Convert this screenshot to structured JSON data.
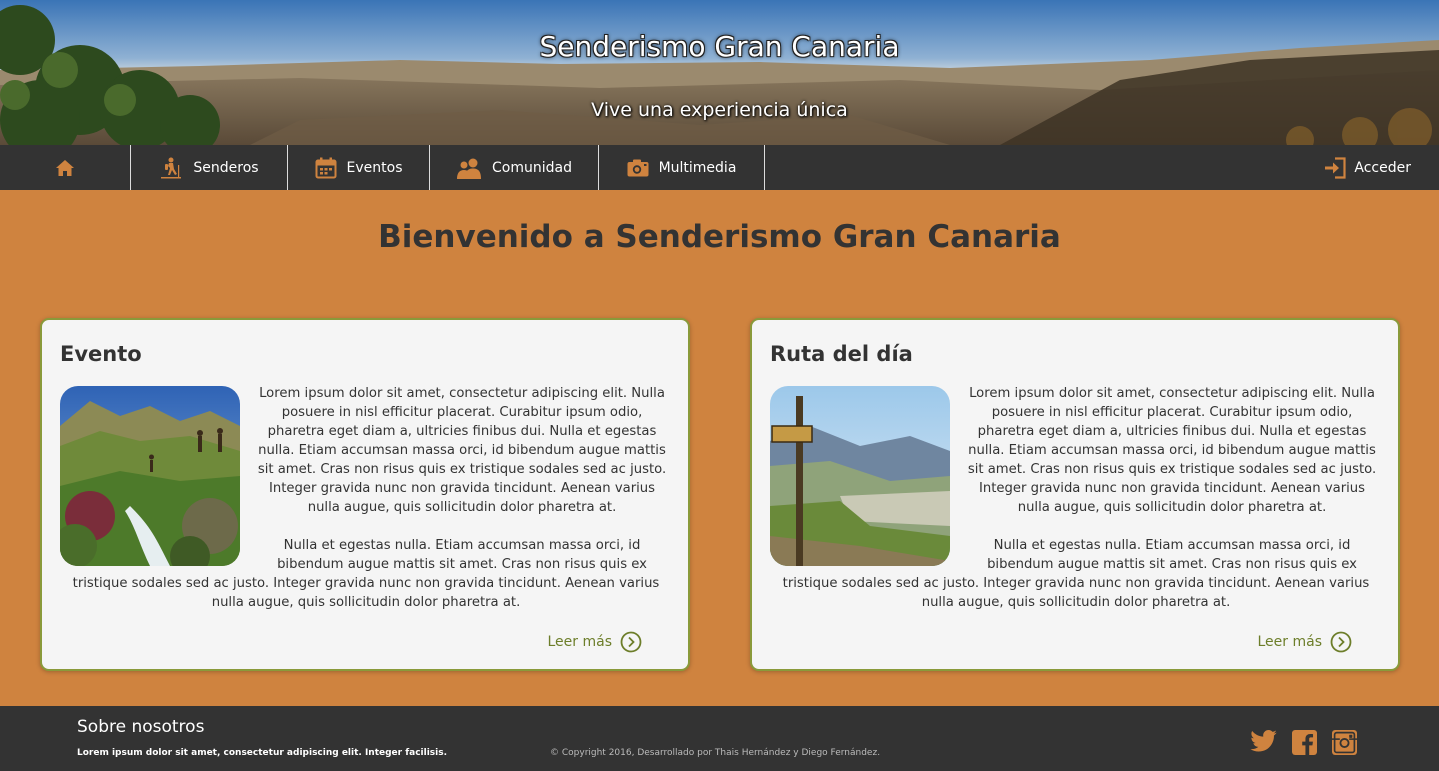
{
  "header": {
    "title": "Senderismo Gran Canaria",
    "subtitle": "Vive una experiencia única"
  },
  "nav": {
    "home_icon": "home-icon",
    "items": [
      {
        "label": "Senderos",
        "icon": "hiker-icon"
      },
      {
        "label": "Eventos",
        "icon": "calendar-icon"
      },
      {
        "label": "Comunidad",
        "icon": "users-icon"
      },
      {
        "label": "Multimedia",
        "icon": "camera-icon"
      }
    ],
    "login": {
      "label": "Acceder",
      "icon": "login-icon"
    }
  },
  "main": {
    "title": "Bienvenido a Senderismo Gran Canaria",
    "cards": [
      {
        "title": "Evento",
        "image": "hikers-mountain-stream-photo",
        "paragraph1": "Lorem ipsum dolor sit amet, consectetur adipiscing elit. Nulla posuere in nisl efficitur placerat. Curabitur ipsum odio, pharetra eget diam a, ultricies finibus dui. Nulla et egestas nulla. Etiam accumsan massa orci, id bibendum augue mattis sit amet. Cras non risus quis ex tristique sodales sed ac justo. Integer gravida nunc non gravida tincidunt. Aenean varius nulla augue, quis sollicitudin dolor pharetra at.",
        "paragraph2": "Nulla et egestas nulla. Etiam accumsan massa orci, id bibendum augue mattis sit amet. Cras non risus quis ex tristique sodales sed ac justo. Integer gravida nunc non gravida tincidunt. Aenean varius nulla augue, quis sollicitudin dolor pharetra at.",
        "link": "Leer más"
      },
      {
        "title": "Ruta del día",
        "image": "trail-signpost-valley-photo",
        "paragraph1": "Lorem ipsum dolor sit amet, consectetur adipiscing elit. Nulla posuere in nisl efficitur placerat. Curabitur ipsum odio, pharetra eget diam a, ultricies finibus dui. Nulla et egestas nulla. Etiam accumsan massa orci, id bibendum augue mattis sit amet. Cras non risus quis ex tristique sodales sed ac justo. Integer gravida nunc non gravida tincidunt. Aenean varius nulla augue, quis sollicitudin dolor pharetra at.",
        "paragraph2": "Nulla et egestas nulla. Etiam accumsan massa orci, id bibendum augue mattis sit amet. Cras non risus quis ex tristique sodales sed ac justo. Integer gravida nunc non gravida tincidunt. Aenean varius nulla augue, quis sollicitudin dolor pharetra at.",
        "link": "Leer más"
      }
    ]
  },
  "footer": {
    "title": "Sobre nosotros",
    "text": "Lorem ipsum dolor sit amet, consectetur adipiscing elit. Integer facilisis.",
    "copyright": "© Copyright 2016, Desarrollado por Thais Hernández y Diego Fernández.",
    "social": [
      "twitter-icon",
      "facebook-icon",
      "instagram-icon"
    ]
  },
  "colors": {
    "accent": "#cf833f",
    "dark": "#333333",
    "link_green": "#6d7e2a",
    "card_border": "#8a9a3a"
  }
}
